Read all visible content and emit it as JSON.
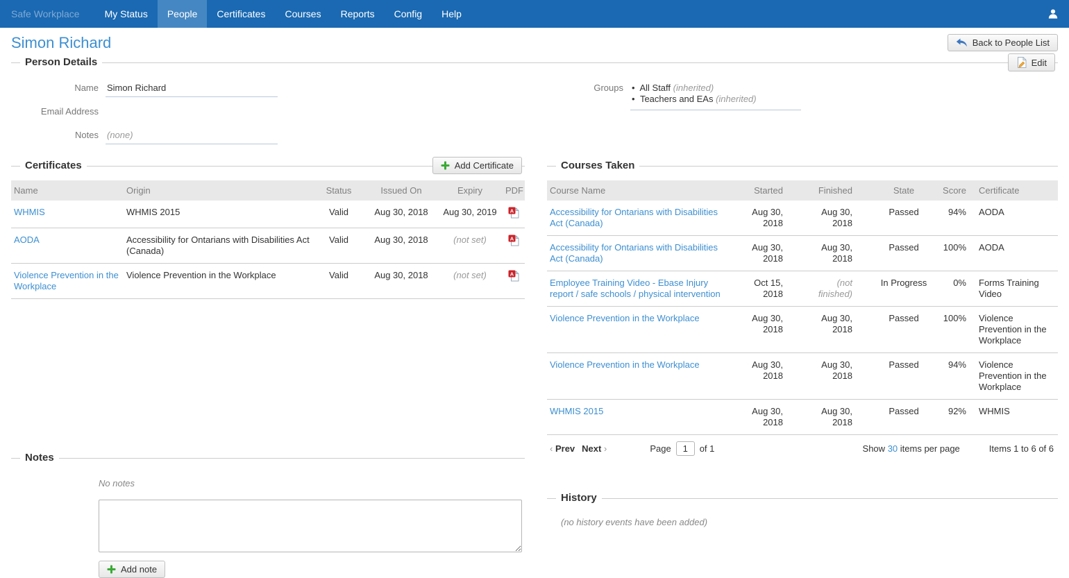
{
  "navbar": {
    "brand": "Safe Workplace",
    "items": [
      {
        "label": "My Status",
        "active": false
      },
      {
        "label": "People",
        "active": true
      },
      {
        "label": "Certificates",
        "active": false
      },
      {
        "label": "Courses",
        "active": false
      },
      {
        "label": "Reports",
        "active": false
      },
      {
        "label": "Config",
        "active": false
      },
      {
        "label": "Help",
        "active": false
      }
    ]
  },
  "page": {
    "title": "Simon Richard",
    "back_button_label": "Back to People List"
  },
  "person_details": {
    "legend": "Person Details",
    "edit_button_label": "Edit",
    "name_label": "Name",
    "name_value": "Simon Richard",
    "email_label": "Email Address",
    "email_value": "",
    "notes_label": "Notes",
    "notes_value": "(none)",
    "groups_label": "Groups",
    "groups": [
      {
        "bullet": "•",
        "name": "All Staff",
        "note": "(inherited)"
      },
      {
        "bullet": "•",
        "name": "Teachers and EAs",
        "note": "(inherited)"
      }
    ]
  },
  "certificates": {
    "legend": "Certificates",
    "add_button_label": "Add Certificate",
    "columns": {
      "name": "Name",
      "origin": "Origin",
      "status": "Status",
      "issued": "Issued On",
      "expiry": "Expiry",
      "pdf": "PDF"
    },
    "rows": [
      {
        "name": "WHMIS",
        "origin": "WHMIS 2015",
        "status": "Valid",
        "issued": "Aug 30, 2018",
        "expiry": "Aug 30, 2019"
      },
      {
        "name": "AODA",
        "origin": "Accessibility for Ontarians with Disabilities Act (Canada)",
        "status": "Valid",
        "issued": "Aug 30, 2018",
        "expiry": "(not set)"
      },
      {
        "name": "Violence Prevention in the Workplace",
        "origin": "Violence Prevention in the Workplace",
        "status": "Valid",
        "issued": "Aug 30, 2018",
        "expiry": "(not set)"
      }
    ]
  },
  "courses": {
    "legend": "Courses Taken",
    "columns": {
      "name": "Course Name",
      "started": "Started",
      "finished": "Finished",
      "state": "State",
      "score": "Score",
      "certificate": "Certificate"
    },
    "rows": [
      {
        "name": "Accessibility for Ontarians with Disabilities Act (Canada)",
        "started": "Aug 30, 2018",
        "finished": "Aug 30, 2018",
        "state": "Passed",
        "score": "94%",
        "certificate": "AODA"
      },
      {
        "name": "Accessibility for Ontarians with Disabilities Act (Canada)",
        "started": "Aug 30, 2018",
        "finished": "Aug 30, 2018",
        "state": "Passed",
        "score": "100%",
        "certificate": "AODA"
      },
      {
        "name": "Employee Training Video - Ebase Injury report / safe schools / physical intervention",
        "started": "Oct 15, 2018",
        "finished": "(not finished)",
        "state": "In Progress",
        "score": "0%",
        "certificate": "Forms Training Video"
      },
      {
        "name": "Violence Prevention in the Workplace",
        "started": "Aug 30, 2018",
        "finished": "Aug 30, 2018",
        "state": "Passed",
        "score": "100%",
        "certificate": "Violence Prevention in the Workplace"
      },
      {
        "name": "Violence Prevention in the Workplace",
        "started": "Aug 30, 2018",
        "finished": "Aug 30, 2018",
        "state": "Passed",
        "score": "94%",
        "certificate": "Violence Prevention in the Workplace"
      },
      {
        "name": "WHMIS 2015",
        "started": "Aug 30, 2018",
        "finished": "Aug 30, 2018",
        "state": "Passed",
        "score": "92%",
        "certificate": "WHMIS"
      }
    ],
    "pagination": {
      "prev_arrow": "‹",
      "prev_label": "Prev",
      "next_label": "Next",
      "next_arrow": "›",
      "page_label": "Page",
      "page_value": "1",
      "of_label": "of 1",
      "show_label": "Show",
      "per_page": "30",
      "per_page_suffix": "items per page",
      "items_label": "Items 1 to 6 of 6"
    }
  },
  "notes_section": {
    "legend": "Notes",
    "empty_text": "No notes",
    "textarea_value": "",
    "add_button_label": "Add note"
  },
  "history_section": {
    "legend": "History",
    "empty_text": "(no history events have been added)"
  },
  "colors": {
    "navbar_bg": "#1a69b2",
    "navbar_active_bg": "#4587c2",
    "brand_text": "#7fa9d6",
    "link_blue": "#3d8fd1",
    "muted_gray": "#888888",
    "table_header_bg": "#e8e8e8",
    "plus_green": "#3aaa35",
    "pdf_red": "#cc2229",
    "underline_blue": "#b9c8da"
  }
}
